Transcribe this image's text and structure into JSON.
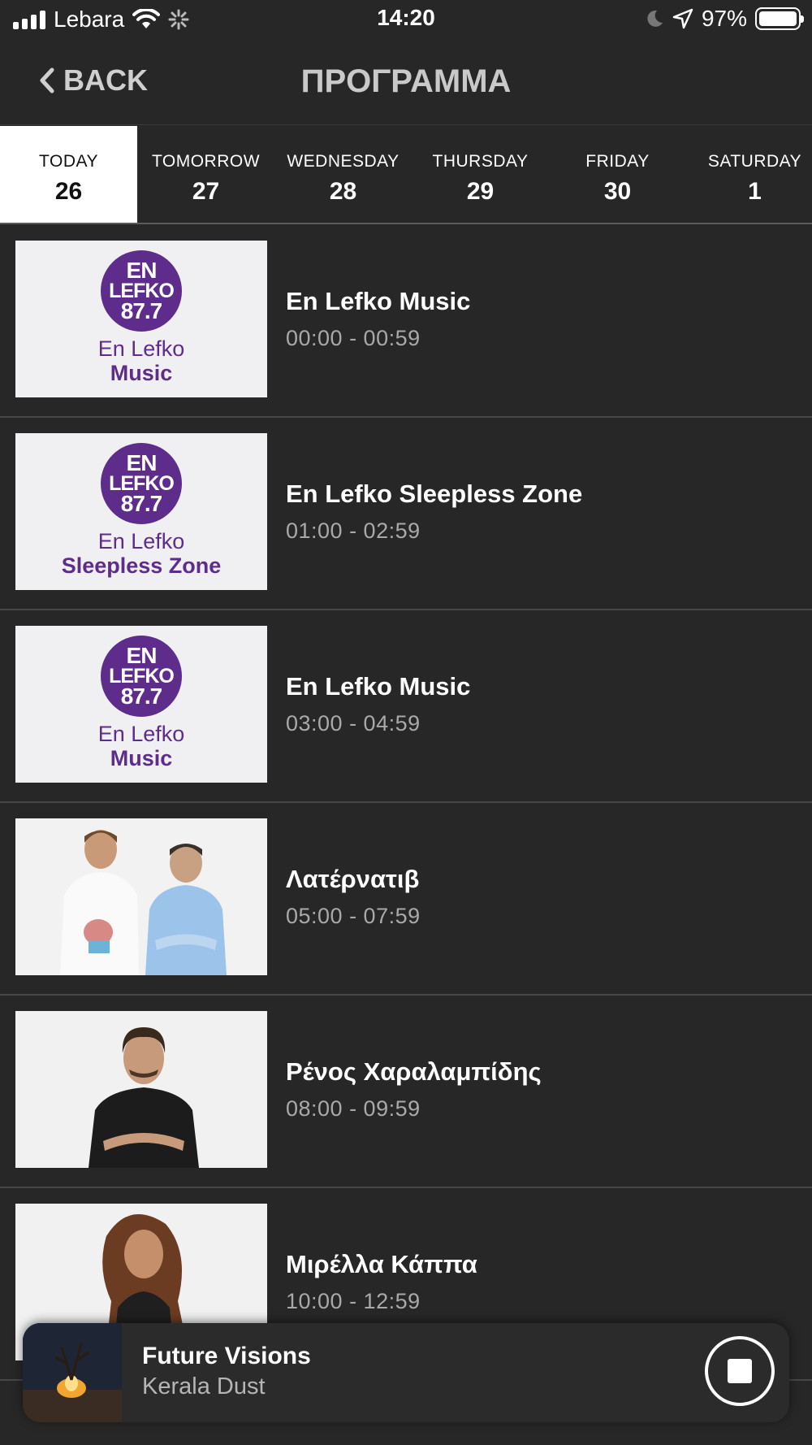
{
  "status_bar": {
    "carrier": "Lebara",
    "time": "14:20",
    "battery": "97%"
  },
  "nav": {
    "back_label": "BACK",
    "title": "ΠΡΟΓΡΑΜΜΑ"
  },
  "days": [
    {
      "name": "TODAY",
      "num": "26",
      "active": true
    },
    {
      "name": "TOMORROW",
      "num": "27"
    },
    {
      "name": "WEDNESDAY",
      "num": "28"
    },
    {
      "name": "THURSDAY",
      "num": "29"
    },
    {
      "name": "FRIDAY",
      "num": "30"
    },
    {
      "name": "SATURDAY",
      "num": "1"
    }
  ],
  "logo": {
    "line1": "EN",
    "line2": "LEFKO",
    "line3": "87.7"
  },
  "programs": [
    {
      "title": "En Lefko Music",
      "time": "00:00 - 00:59",
      "thumb_line1": "En Lefko",
      "thumb_line2": "Music"
    },
    {
      "title": "En Lefko Sleepless Zone",
      "time": "01:00 - 02:59",
      "thumb_line1": "En Lefko",
      "thumb_line2": "Sleepless Zone"
    },
    {
      "title": "En Lefko Music",
      "time": "03:00 - 04:59",
      "thumb_line1": "En Lefko",
      "thumb_line2": "Music"
    },
    {
      "title": "Λατέρνατιβ",
      "time": "05:00 - 07:59"
    },
    {
      "title": "Ρένος Χαραλαμπίδης",
      "time": "08:00 - 09:59"
    },
    {
      "title": "Μιρέλλα Κάππα",
      "time": "10:00 - 12:59"
    }
  ],
  "now_playing": {
    "title": "Future Visions",
    "artist": "Kerala Dust"
  },
  "colors": {
    "background": "#272727",
    "brand_purple": "#5e2d8c",
    "active_tab": "#ffffff"
  }
}
